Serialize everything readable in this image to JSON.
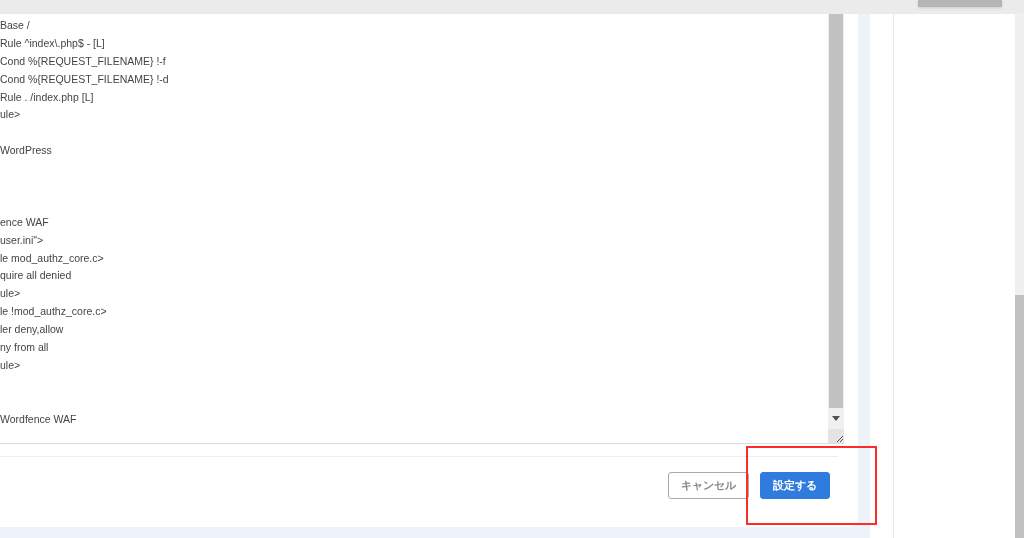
{
  "editor": {
    "lines": [
      {
        "kind": "text",
        "text": "Base /"
      },
      {
        "kind": "text",
        "text": "Rule ^index\\.php$ - [L]"
      },
      {
        "kind": "text",
        "text": "Cond %{REQUEST_FILENAME} !-f"
      },
      {
        "kind": "text",
        "text": "Cond %{REQUEST_FILENAME} !-d"
      },
      {
        "kind": "text",
        "text": "Rule . /index.php [L]"
      },
      {
        "kind": "text",
        "text": "ule>"
      },
      {
        "kind": "blank"
      },
      {
        "kind": "text",
        "text": "WordPress"
      },
      {
        "kind": "blank"
      },
      {
        "kind": "blank"
      },
      {
        "kind": "blank"
      },
      {
        "kind": "text",
        "text": "ence WAF"
      },
      {
        "kind": "text",
        "text": "user.ini\">"
      },
      {
        "kind": "text",
        "text": "le mod_authz_core.c>"
      },
      {
        "kind": "text",
        "text": "quire all denied"
      },
      {
        "kind": "text",
        "text": "ule>"
      },
      {
        "kind": "text",
        "text": "le !mod_authz_core.c>"
      },
      {
        "kind": "text",
        "text": "ler deny,allow"
      },
      {
        "kind": "text",
        "text": "ny from all"
      },
      {
        "kind": "text",
        "text": "ule>"
      },
      {
        "kind": "blank"
      },
      {
        "kind": "blank"
      },
      {
        "kind": "text",
        "text": "Wordfence WAF"
      }
    ]
  },
  "buttons": [
    {
      "kind": "secondary",
      "label": "キャンセル"
    },
    {
      "kind": "primary",
      "label": "設定する"
    }
  ]
}
